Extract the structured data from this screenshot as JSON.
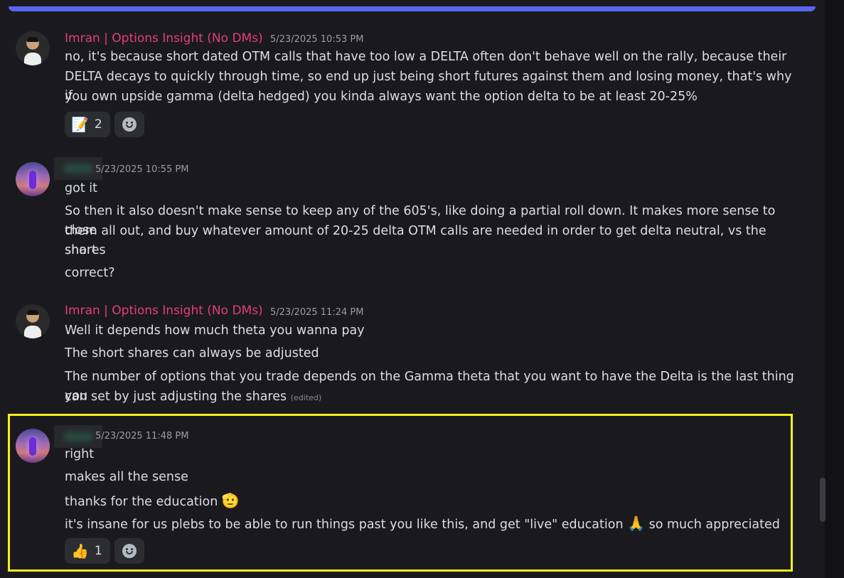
{
  "messages": [
    {
      "author": "Imran | Options Insight (No DMs)",
      "timestamp": "5/23/2025 10:53 PM",
      "lines": [
        "no, it's because short dated OTM calls that have too low a DELTA often don't behave well on the rally, because their",
        "DELTA decays to quickly through time, so end up just being short futures against them and losing money, that's why if",
        "you own upside gamma (delta hedged) you kinda always want the option delta to be at least 20-25%"
      ],
      "reaction": {
        "emoji": "📝",
        "count": "2"
      }
    },
    {
      "author": "",
      "timestamp": "5/23/2025 10:55 PM",
      "lines": [
        "got it",
        "So then it also doesn't make sense to keep any of the 605's, like doing a partial roll down. It makes more sense to close",
        "them all out, and buy whatever amount of 20-25 delta OTM calls are needed in order to get delta neutral, vs the short",
        "shares",
        "correct?"
      ]
    },
    {
      "author": "Imran | Options Insight (No DMs)",
      "timestamp": "5/23/2025 11:24 PM",
      "lines": [
        "Well it depends how much theta you wanna pay",
        "The short shares can always be adjusted",
        "The number of options that you trade depends on the Gamma theta that you want to have the Delta is the last thing you",
        "can set by just adjusting the shares"
      ],
      "edited_label": "(edited)"
    },
    {
      "author": "",
      "timestamp": "5/23/2025 11:48 PM",
      "lines": [
        "right",
        "makes all the sense",
        "thanks for the education",
        "it's insane for us plebs to be able to run things past you like this, and get \"live\" education",
        "so much appreciated"
      ],
      "emojis": {
        "salute": "🫡",
        "pray": "🙏"
      },
      "reaction": {
        "emoji": "👍",
        "count": "1"
      }
    }
  ],
  "colors": {
    "background": "#1a1a1e",
    "author_name": "#e33f73",
    "highlight": "#f5ef1a",
    "top_accent": "#5865f2"
  },
  "icons": {
    "add_reaction": "smiley-icon"
  }
}
